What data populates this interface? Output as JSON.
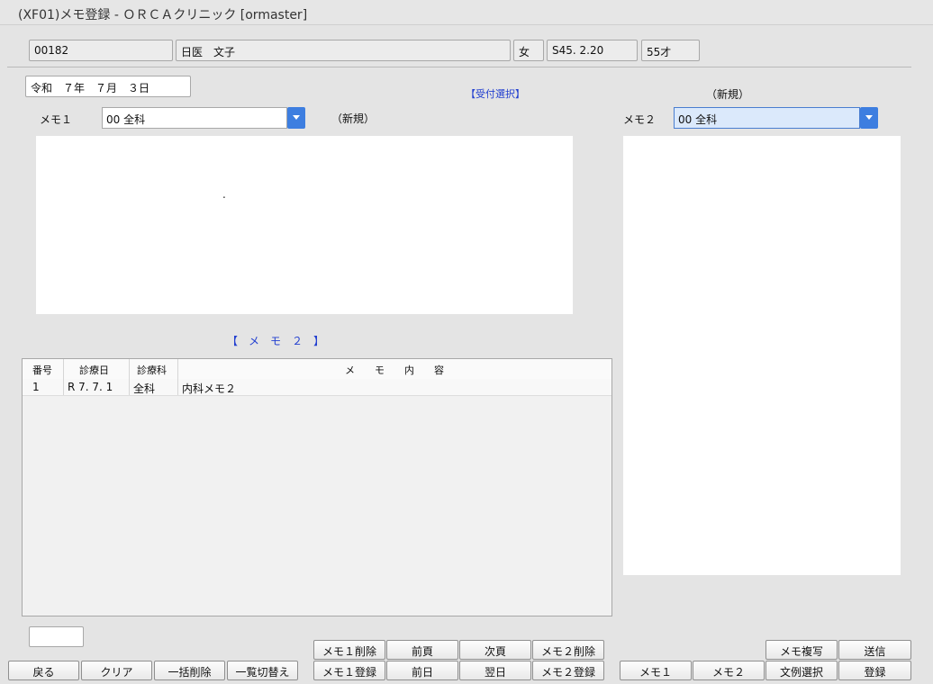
{
  "window": {
    "title": "(XF01)メモ登録 - ＯＲＣＡクリニック [ormaster]"
  },
  "patient": {
    "id": "00182",
    "name": "日医　文子",
    "sex": "女",
    "birth": "S45. 2.20",
    "age": "55才"
  },
  "date": {
    "value": "令和　７年　７月　３日"
  },
  "reception_select": "【受付選択】",
  "memo1": {
    "label": "メモ１",
    "dept": "00 全科",
    "status": "（新規）",
    "text": "."
  },
  "memo2": {
    "label": "メモ２",
    "dept": "00 全科",
    "status": "（新規）",
    "text": ""
  },
  "memo2_list": {
    "title": "【　メ　モ　２　】",
    "columns": [
      "番号",
      "診療日",
      "診療科",
      "メ　　モ　　内　　容"
    ],
    "rows": [
      {
        "no": "1",
        "date": "R 7. 7. 1",
        "dept": "全科",
        "content": "内科メモ２"
      }
    ]
  },
  "small_input": {
    "value": ""
  },
  "buttons": {
    "back": "戻る",
    "clear": "クリア",
    "bulk_delete": "一括削除",
    "list_toggle": "一覧切替え",
    "memo1_delete": "メモ１削除",
    "memo1_register": "メモ１登録",
    "prev_page": "前頁",
    "prev_day": "前日",
    "next_page": "次頁",
    "next_day": "翌日",
    "memo2_delete": "メモ２削除",
    "memo2_register": "メモ２登録",
    "memo1": "メモ１",
    "memo2": "メモ２",
    "memo_copy": "メモ複写",
    "example_select": "文例選択",
    "send": "送信",
    "register": "登録"
  }
}
